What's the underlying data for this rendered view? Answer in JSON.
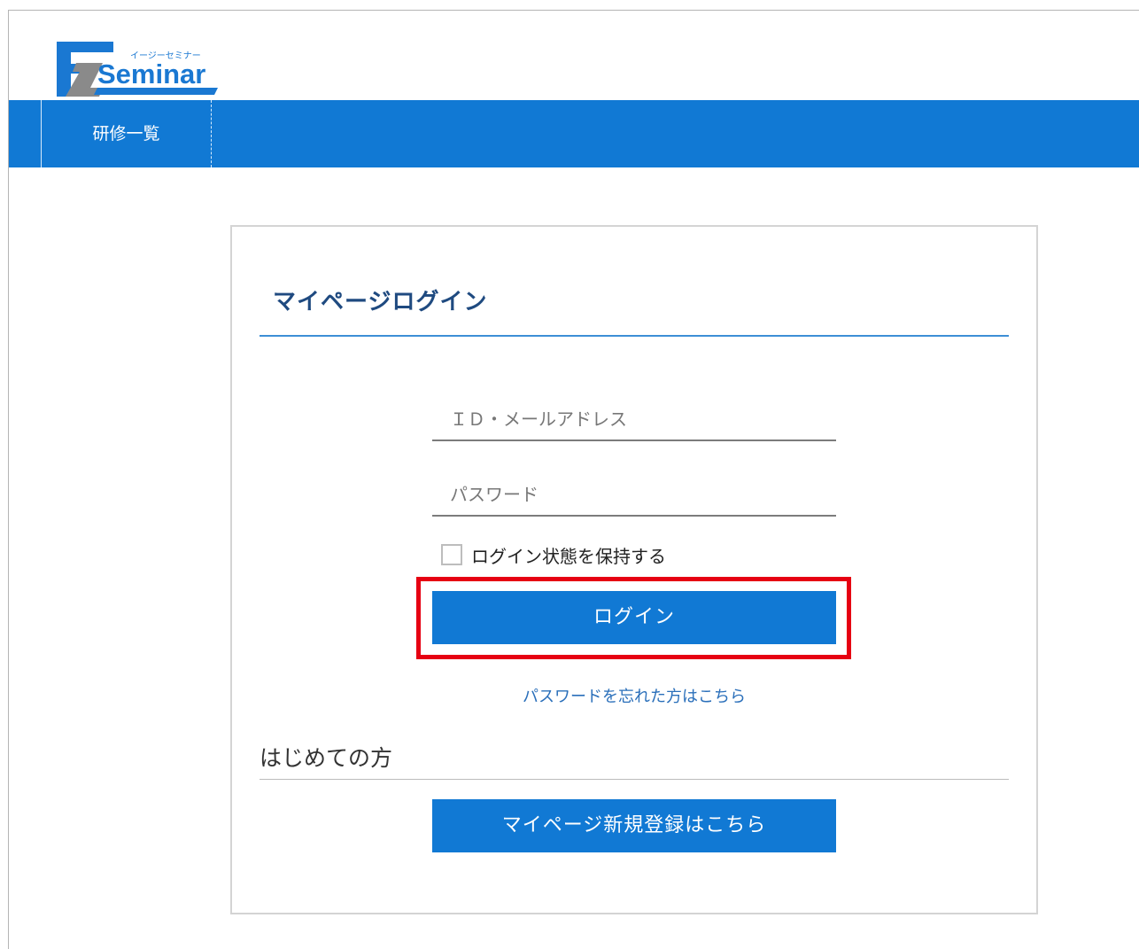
{
  "brand": {
    "logo_letters": "EZ",
    "logo_kana": "イージーセミナー",
    "logo_word": "Seminar",
    "colors": {
      "primary": "#1179d4",
      "logo_blue": "#1a78d2",
      "logo_gray": "#8a8a8a",
      "highlight": "#e60012"
    }
  },
  "nav": {
    "items": [
      {
        "label": "研修一覧"
      }
    ]
  },
  "login": {
    "title": "マイページログイン",
    "id_placeholder": "ＩＤ・メールアドレス",
    "password_placeholder": "パスワード",
    "remember_label": "ログイン状態を保持する",
    "remember_checked": false,
    "submit_label": "ログイン",
    "forgot_link": "パスワードを忘れた方はこちら"
  },
  "first_time": {
    "heading": "はじめての方",
    "register_label": "マイページ新規登録はこちら"
  }
}
